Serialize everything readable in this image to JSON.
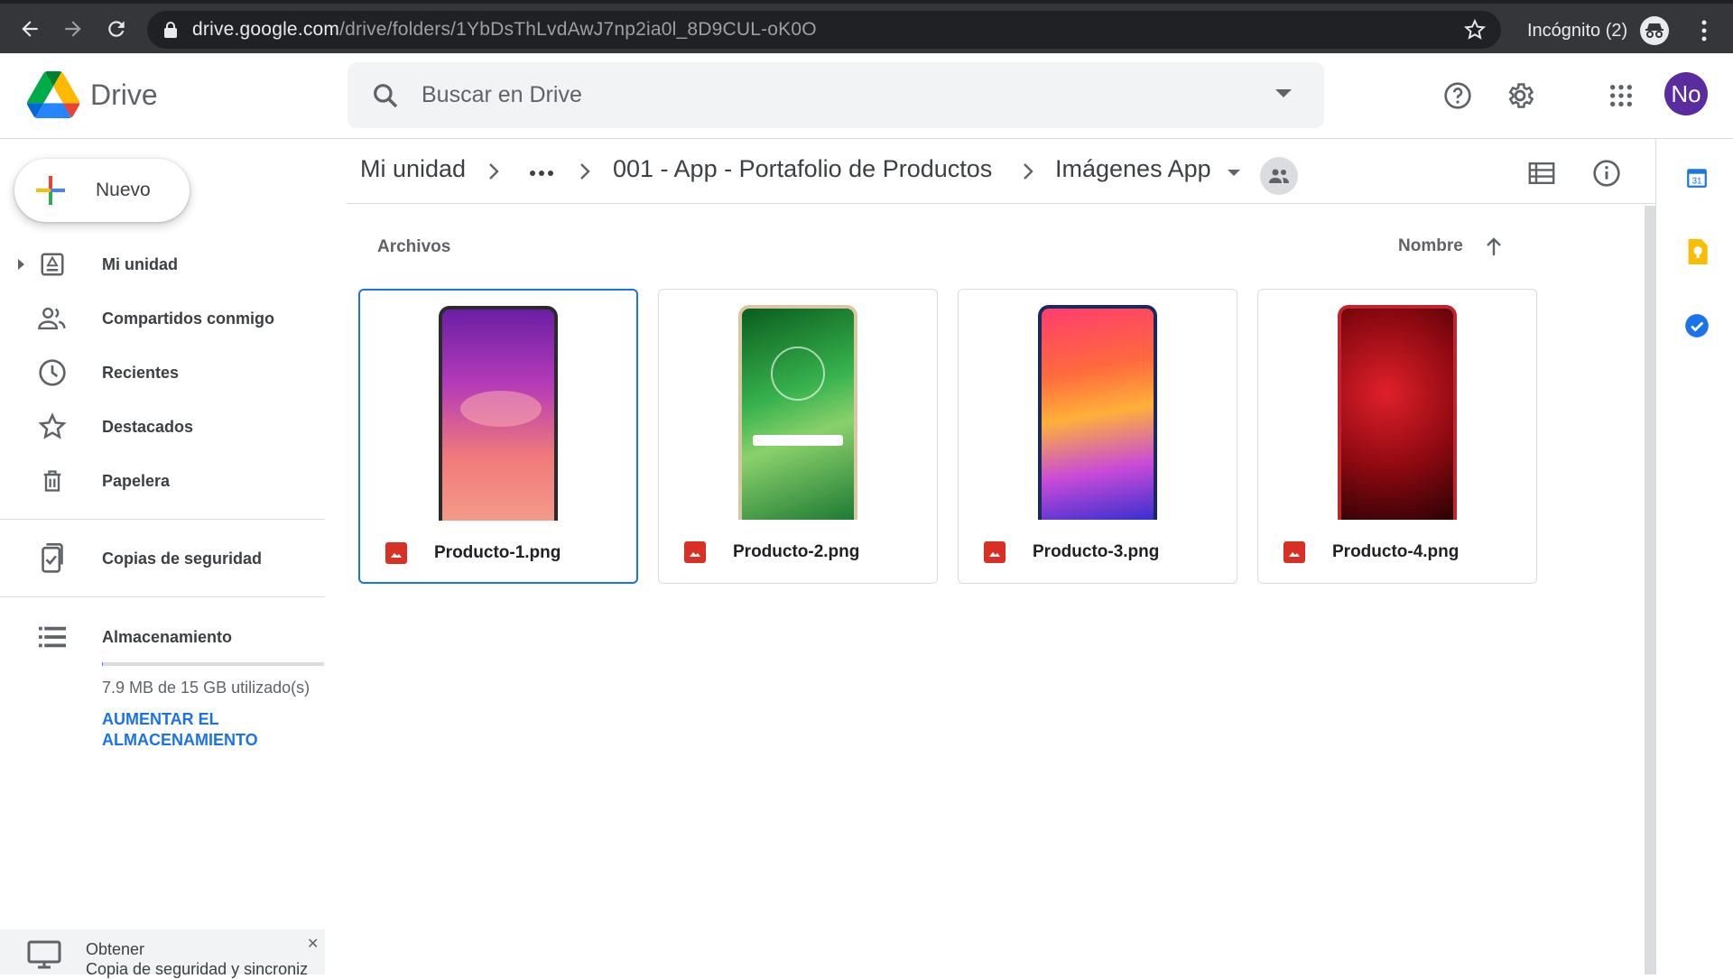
{
  "browser": {
    "url_host": "drive.google.com",
    "url_path": "/drive/folders/1YbDsThLvdAwJ7np2ia0l_8D9CUL-oK0O",
    "incognito_label": "Incógnito (2)"
  },
  "header": {
    "logo_text": "Drive",
    "search_placeholder": "Buscar en Drive",
    "avatar_initials": "No",
    "colors": {
      "avatar": "#5b2ca0",
      "accent": "#1a73e8"
    }
  },
  "sidebar": {
    "new_button": "Nuevo",
    "items": [
      {
        "label": "Mi unidad",
        "icon": "my-drive-icon"
      },
      {
        "label": "Compartidos conmigo",
        "icon": "shared-people-icon"
      },
      {
        "label": "Recientes",
        "icon": "clock-icon"
      },
      {
        "label": "Destacados",
        "icon": "star-icon"
      },
      {
        "label": "Papelera",
        "icon": "trash-icon"
      },
      {
        "label": "Copias de seguridad",
        "icon": "backup-icon"
      },
      {
        "label": "Almacenamiento",
        "icon": "storage-icon"
      }
    ],
    "storage": {
      "used_text": "7.9 MB de 15 GB utilizado(s)",
      "used_fraction": 0.0005,
      "upgrade_link": "AUMENTAR EL ALMACENAMIENTO"
    },
    "backup_promo": {
      "title": "Obtener",
      "subtitle": "Copia de seguridad y sincroniz"
    }
  },
  "breadcrumb": {
    "root": "Mi unidad",
    "parent": "001 - App - Portafolio de Productos",
    "current": "Imágenes App"
  },
  "files": {
    "section_label": "Archivos",
    "sort_label": "Nombre",
    "items": [
      {
        "name": "Producto-1.png",
        "selected": true
      },
      {
        "name": "Producto-2.png",
        "selected": false
      },
      {
        "name": "Producto-3.png",
        "selected": false
      },
      {
        "name": "Producto-4.png",
        "selected": false
      }
    ]
  }
}
